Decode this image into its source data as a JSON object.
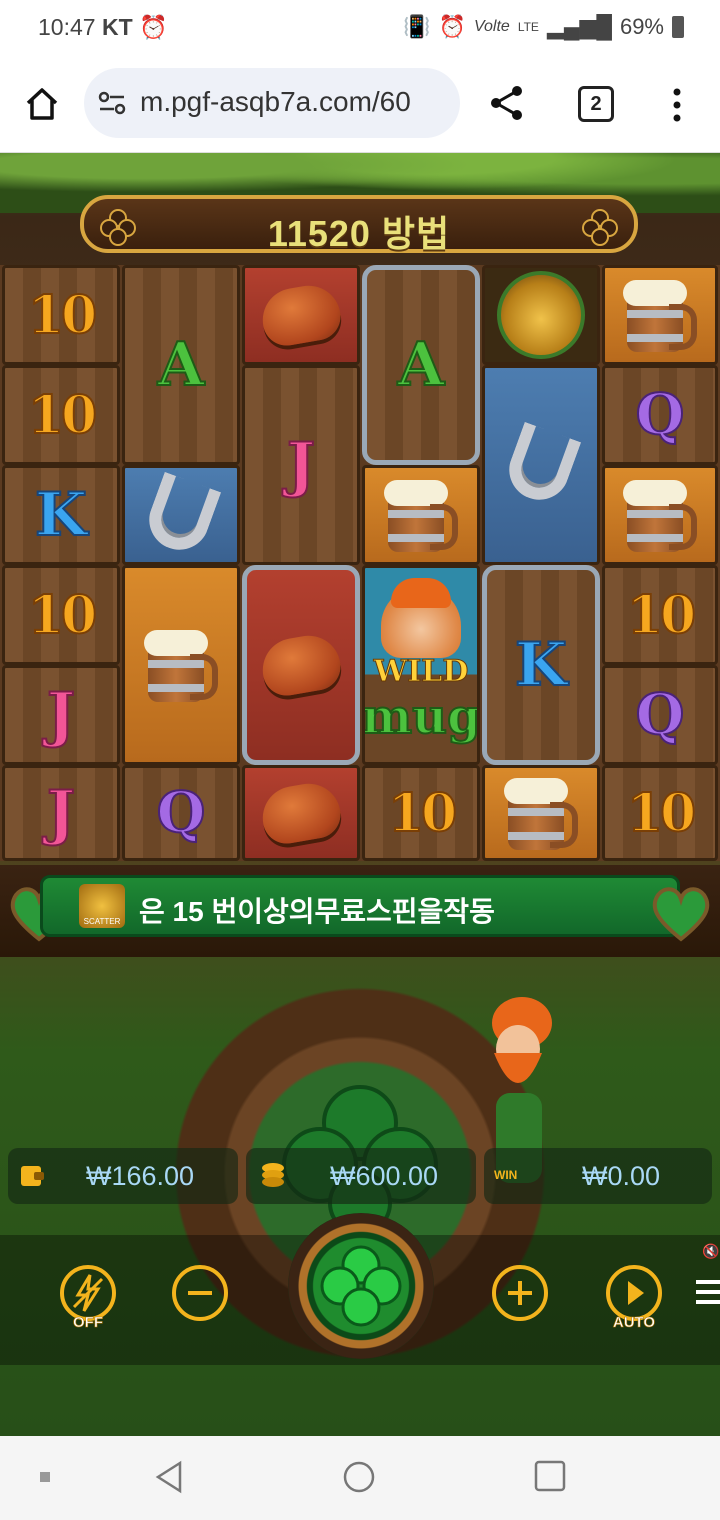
{
  "status_bar": {
    "time": "10:47",
    "carrier": "KT",
    "volte": "Volte",
    "lte": "LTE",
    "battery": "69%"
  },
  "browser": {
    "url": "m.pgf-asqb7a.com/60",
    "tab_count": "2"
  },
  "game": {
    "ways_text": "11520 방법",
    "grid": [
      [
        "10",
        "10",
        "K",
        "10",
        "J",
        "J"
      ],
      [
        "A",
        "J",
        "shoe",
        "mug",
        "bread",
        "Q"
      ],
      [
        "bread",
        "J",
        "bread",
        "bread",
        "J",
        "bread"
      ],
      [
        "A",
        "J",
        "mug",
        "WILD",
        "A",
        "10"
      ],
      [
        "pot",
        "shoe",
        "K",
        "mug",
        "A",
        "10"
      ],
      [
        "mug",
        "Q",
        "mug",
        "10",
        "Q",
        "10"
      ]
    ],
    "wild_label": "WILD",
    "scatter_label": "SCATTER",
    "message": "은 15 번이상의무료스핀을작동",
    "balance": "₩166.00",
    "bet": "₩600.00",
    "win": "₩0.00",
    "win_icon_label": "WIN",
    "turbo_label": "OFF",
    "auto_label": "AUTO",
    "colors": {
      "balance_text": "#a9d8f5",
      "gold": "#f3b41d",
      "message_green": "#1f8a35"
    }
  }
}
